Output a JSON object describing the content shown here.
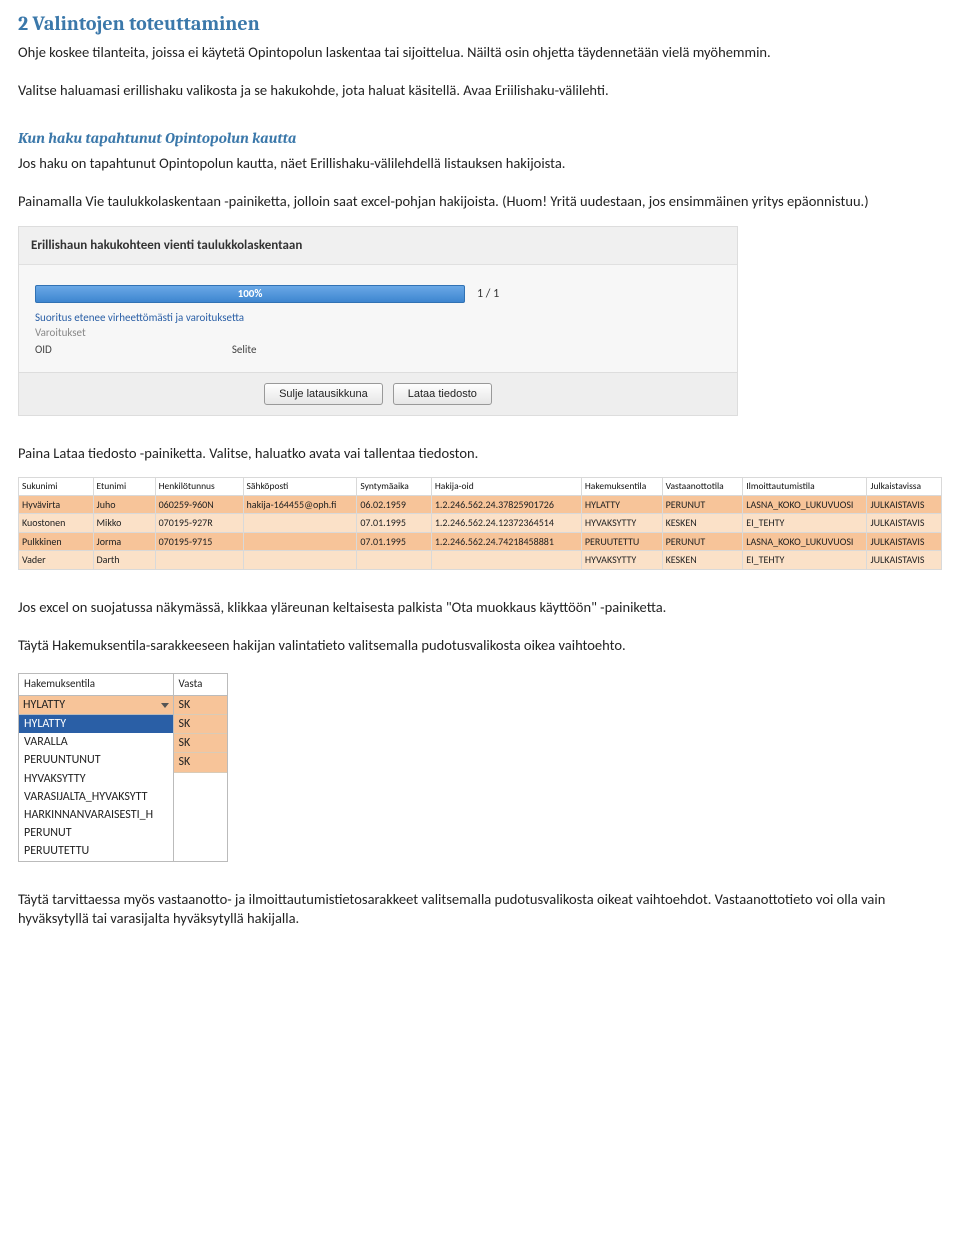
{
  "heading": "2 Valintojen toteuttaminen",
  "intro1": "Ohje koskee tilanteita, joissa ei käytetä Opintopolun laskentaa tai sijoittelua. Näiltä osin ohjetta täydennetään vielä myöhemmin.",
  "intro2": "Valitse haluamasi erillishaku valikosta ja se hakukohde, jota haluat käsitellä. Avaa Eriilishaku-välilehti.",
  "sub1": "Kun haku tapahtunut Opintopolun kautta",
  "sub1_body1": "Jos haku on tapahtunut Opintopolun kautta, näet Erillishaku-välilehdellä listauksen hakijoista.",
  "sub1_body2": "Painamalla Vie taulukkolaskentaan -painiketta, jolloin saat excel-pohjan hakijoista. (Huom! Yritä uudestaan, jos ensimmäinen yritys epäonnistuu.)",
  "dialog": {
    "title": "Erillishaun hakukohteen vienti taulukkolaskentaan",
    "progress_pct": "100%",
    "progress_count": "1 / 1",
    "ok_msg": "Suoritus etenee virheettömästi ja varoituksetta",
    "warn_label": "Varoitukset",
    "col_oid": "OID",
    "col_selite": "Selite",
    "btn_close": "Sulje latausikkuna",
    "btn_download": "Lataa tiedosto"
  },
  "after_dialog": "Paina Lataa tiedosto -painiketta. Valitse, haluatko avata vai tallentaa tiedoston.",
  "table": {
    "headers": [
      "Sukunimi",
      "Etunimi",
      "Henkilötunnus",
      "Sähköposti",
      "Syntymäaika",
      "Hakija-oid",
      "Hakemuksentila",
      "Vastaanottotila",
      "Ilmoittautumistila",
      "Julkaistavissa"
    ],
    "rows": [
      {
        "cells": [
          "Hyvävirta",
          "Juho",
          "060259-960N",
          "hakija-164455@oph.fi",
          "06.02.1959",
          "1.2.246.562.24.37825901726",
          "HYLATTY",
          "PERUNUT",
          "LASNA_KOKO_LUKUVUOSI",
          "JULKAISTAVIS"
        ],
        "light": false
      },
      {
        "cells": [
          "Kuostonen",
          "Mikko",
          "070195-927R",
          "",
          "07.01.1995",
          "1.2.246.562.24.12372364514",
          "HYVAKSYTTY",
          "KESKEN",
          "EI_TEHTY",
          "JULKAISTAVIS"
        ],
        "light": true
      },
      {
        "cells": [
          "Pulkkinen",
          "Jorma",
          "070195-9715",
          "",
          "07.01.1995",
          "1.2.246.562.24.74218458881",
          "PERUUTETTU",
          "PERUNUT",
          "LASNA_KOKO_LUKUVUOSI",
          "JULKAISTAVIS"
        ],
        "light": false
      },
      {
        "cells": [
          "Vader",
          "Darth",
          "",
          "",
          "",
          "",
          "HYVAKSYTTY",
          "KESKEN",
          "EI_TEHTY",
          "JULKAISTAVIS"
        ],
        "light": true,
        "greyCol": 5
      }
    ]
  },
  "after_table1": "Jos excel on suojatussa näkymässä, klikkaa yläreunan keltaisesta palkista \"Ota muokkaus käyttöön\" -painiketta.",
  "after_table2": "Täytä Hakemuksentila-sarakkeeseen hakijan valintatieto valitsemalla pudotusvalikosta oikea vaihtoehto.",
  "dropdown": {
    "header1": "Hakemuksentila",
    "header2": "Vasta",
    "selected": "HYLATTY",
    "options": [
      "HYLATTY",
      "VARALLA",
      "PERUUNTUNUT",
      "HYVAKSYTTY",
      "VARASIJALTA_HYVAKSYTT",
      "HARKINNANVARAISESTI_H",
      "PERUNUT",
      "PERUUTETTU"
    ],
    "sk_values": [
      "SK",
      "SK",
      "SK",
      "SK"
    ]
  },
  "closing": "Täytä tarvittaessa myös vastaanotto- ja ilmoittautumistietosarakkeet valitsemalla pudotusvalikosta oikeat vaihtoehdot. Vastaanottotieto voi olla vain hyväksytyllä tai varasijalta hyväksytyllä hakijalla."
}
